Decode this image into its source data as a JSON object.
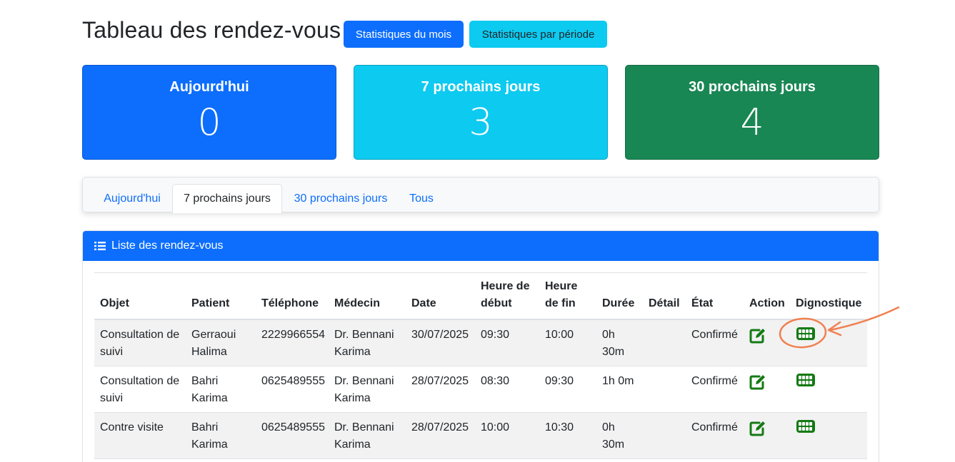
{
  "header": {
    "title": "Tableau des rendez-vous",
    "btn_month": "Statistiques du mois",
    "btn_period": "Statistiques par période"
  },
  "cards": [
    {
      "label": "Aujourd'hui",
      "value": "0",
      "color": "#0d6efd"
    },
    {
      "label": "7 prochains jours",
      "value": "3",
      "color": "#0dcaf0"
    },
    {
      "label": "30 prochains jours",
      "value": "4",
      "color": "#198754"
    }
  ],
  "tabs": [
    {
      "label": "Aujourd'hui",
      "active": false
    },
    {
      "label": "7 prochains jours",
      "active": true
    },
    {
      "label": "30 prochains jours",
      "active": false
    },
    {
      "label": "Tous",
      "active": false
    }
  ],
  "list": {
    "title": "Liste des rendez-vous",
    "icon": "list-icon",
    "columns": [
      "Objet",
      "Patient",
      "Téléphone",
      "Médecin",
      "Date",
      "Heure de début",
      "Heure de fin",
      "Durée",
      "Détail",
      "État",
      "Action",
      "Dignostique"
    ],
    "rows": [
      {
        "objet": "Consultation de suivi",
        "patient": "Gerraoui Halima",
        "telephone": "2229966554",
        "medecin": "Dr. Bennani Karima",
        "date": "30/07/2025",
        "debut": "09:30",
        "fin": "10:00",
        "duree": "0h 30m",
        "detail": "",
        "etat": "Confirmé"
      },
      {
        "objet": "Consultation de suivi",
        "patient": "Bahri Karima",
        "telephone": "0625489555",
        "medecin": "Dr. Bennani Karima",
        "date": "28/07/2025",
        "debut": "08:30",
        "fin": "09:30",
        "duree": "1h 0m",
        "detail": "",
        "etat": "Confirmé"
      },
      {
        "objet": "Contre visite",
        "patient": "Bahri Karima",
        "telephone": "0625489555",
        "medecin": "Dr. Bennani Karima",
        "date": "28/07/2025",
        "debut": "10:00",
        "fin": "10:30",
        "duree": "0h 30m",
        "detail": "",
        "etat": "Confirmé"
      }
    ]
  },
  "icons": {
    "action": "edit-icon",
    "diagnostic": "teeth-icon"
  },
  "colors": {
    "primary": "#0d6efd",
    "info": "#0dcaf0",
    "success": "#198754",
    "icon_green": "#157a15",
    "annotation": "#f08050"
  }
}
